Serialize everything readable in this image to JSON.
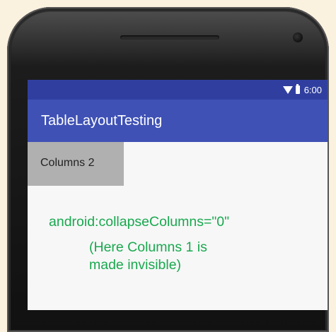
{
  "status_bar": {
    "time": "6:00",
    "icons": [
      "wifi-icon",
      "battery-icon"
    ],
    "color": "#303f9f"
  },
  "app_bar": {
    "title": "TableLayoutTesting",
    "color": "#3f51b5"
  },
  "table": {
    "cell_label": "Columns 2",
    "cell_color": "#b0b0b0"
  },
  "annotation": {
    "code": "android:collapseColumns=\"0\"",
    "note_lines": [
      "(Here Columns 1 is",
      "made invisible)"
    ],
    "color": "#19a84f"
  }
}
